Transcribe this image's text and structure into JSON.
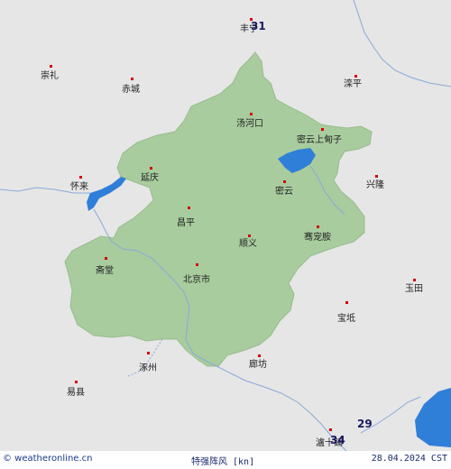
{
  "map": {
    "colors": {
      "background": "#e6e6e6",
      "region": "#a8cc9e",
      "water": "#2f7fd8",
      "border": "#8aa9d8",
      "city_dot": "#d40000"
    },
    "cities": [
      {
        "key": "fengning",
        "name": "丰宁"
      },
      {
        "key": "chongli",
        "name": "崇礼"
      },
      {
        "key": "chicheng",
        "name": "赤城"
      },
      {
        "key": "luanping",
        "name": "滦平"
      },
      {
        "key": "tanghekou",
        "name": "汤河口"
      },
      {
        "key": "miyun-shangdianzi",
        "name": "密云上甸子"
      },
      {
        "key": "huailai",
        "name": "怀来"
      },
      {
        "key": "yanqing",
        "name": "延庆"
      },
      {
        "key": "xinglong",
        "name": "兴隆"
      },
      {
        "key": "miyun",
        "name": "密云"
      },
      {
        "key": "changping",
        "name": "昌平"
      },
      {
        "key": "shunyi",
        "name": "顺义"
      },
      {
        "key": "saichongsheng",
        "name": "骞宠胺"
      },
      {
        "key": "zhaitang",
        "name": "斋堂"
      },
      {
        "key": "beijing",
        "name": "北京市"
      },
      {
        "key": "yutian",
        "name": "玉田"
      },
      {
        "key": "baodi",
        "name": "宝坻"
      },
      {
        "key": "zhuozhou",
        "name": "涿州"
      },
      {
        "key": "langfang",
        "name": "廊坊"
      },
      {
        "key": "yixian",
        "name": "易县"
      },
      {
        "key": "zhenshipu",
        "name": "瀘十鋪"
      }
    ],
    "wind_values": [
      {
        "key": "north",
        "value": "31"
      },
      {
        "key": "southeast",
        "value": "29"
      },
      {
        "key": "south",
        "value": "34"
      }
    ]
  },
  "footer": {
    "source": "© weatheronline.cn",
    "title": "特强阵风  [kn]",
    "date": "28.04.2024 CST"
  }
}
